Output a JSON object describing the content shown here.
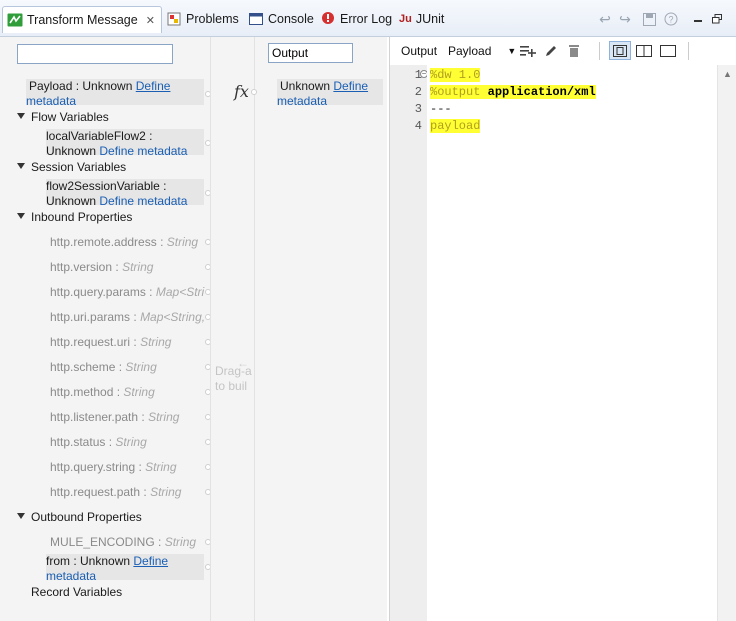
{
  "tabs": [
    {
      "label": "Transform Message",
      "icon": "transform-icon",
      "close": "✕"
    },
    {
      "label": "Problems",
      "icon": "problems-icon"
    },
    {
      "label": "Console",
      "icon": "console-icon"
    },
    {
      "label": "Error Log",
      "icon": "error-log-icon"
    },
    {
      "label": "JUnit",
      "icon": "junit-icon",
      "prefix": "Ju"
    }
  ],
  "input_tree": {
    "search_value": "",
    "payload": {
      "label": "Payload : Unknown",
      "link": "Define metadata"
    },
    "flow_variables": {
      "label": "Flow Variables",
      "items": [
        {
          "label": "localVariableFlow2 :",
          "sub": "Unknown",
          "link": "Define metadata"
        }
      ]
    },
    "session_variables": {
      "label": "Session Variables",
      "items": [
        {
          "label": "flow2SessionVariable :",
          "sub": "Unknown",
          "link": "Define metadata"
        }
      ]
    },
    "inbound_properties": {
      "label": "Inbound Properties",
      "items": [
        {
          "name": "http.remote.address",
          "type": "String"
        },
        {
          "name": "http.version",
          "type": "String"
        },
        {
          "name": "http.query.params",
          "type": "Map<Stri"
        },
        {
          "name": "http.uri.params",
          "type": "Map<String,"
        },
        {
          "name": "http.request.uri",
          "type": "String"
        },
        {
          "name": "http.scheme",
          "type": "String"
        },
        {
          "name": "http.method",
          "type": "String"
        },
        {
          "name": "http.listener.path",
          "type": "String"
        },
        {
          "name": "http.status",
          "type": "String"
        },
        {
          "name": "http.query.string",
          "type": "String"
        },
        {
          "name": "http.request.path",
          "type": "String"
        }
      ]
    },
    "outbound_properties": {
      "label": "Outbound Properties",
      "items": [
        {
          "name": "MULE_ENCODING",
          "type": "String"
        }
      ],
      "from": {
        "label": "from : Unknown",
        "link": "Define metadata"
      }
    },
    "record_variables": {
      "label": "Record Variables"
    }
  },
  "connector": {
    "fx": "fx",
    "drag_hint_1": "Drag-a",
    "drag_hint_2": "to buil"
  },
  "output_tree": {
    "search_value": "Output",
    "item": {
      "label": "Unknown",
      "link": "Define metadata"
    }
  },
  "editor": {
    "output_label": "Output",
    "payload_label": "Payload",
    "lines": [
      {
        "num": "1",
        "text": "%dw 1.0"
      },
      {
        "num": "2",
        "directive": "%output",
        "value": "application/xml"
      },
      {
        "num": "3",
        "text": "---"
      },
      {
        "num": "4",
        "text": "payload"
      }
    ]
  }
}
